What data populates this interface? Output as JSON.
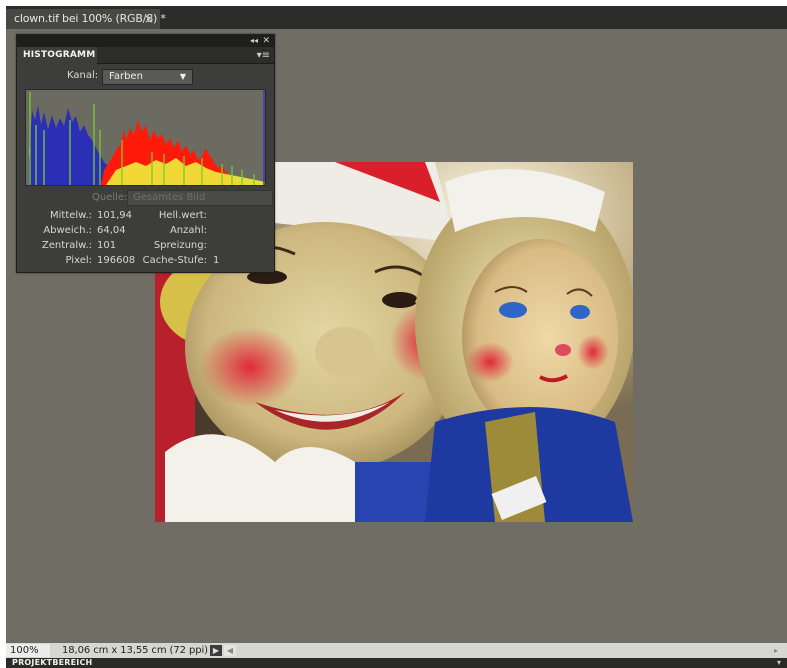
{
  "document_tab": {
    "title": "clown.tif bei 100% (RGB/8) *",
    "close_glyph": "×"
  },
  "histogram_panel": {
    "tab_label": "HISTOGRAMM",
    "collapse_icon": "double-chevron-left-icon",
    "close_icon": "close-icon",
    "menu_icon": "panel-menu-icon",
    "kanal_label": "Kanal:",
    "kanal_value": "Farben",
    "quelle_label": "Quelle:",
    "quelle_value": "Gesamtes Bild",
    "stats_left": [
      {
        "label": "Mittelw.:",
        "value": "101,94"
      },
      {
        "label": "Abweich.:",
        "value": "64,04"
      },
      {
        "label": "Zentralw.:",
        "value": "101"
      },
      {
        "label": "Pixel:",
        "value": "196608"
      }
    ],
    "stats_right": [
      {
        "label": "Hell.wert:",
        "value": ""
      },
      {
        "label": "Anzahl:",
        "value": ""
      },
      {
        "label": "Spreizung:",
        "value": ""
      },
      {
        "label": "Cache-Stufe:",
        "value": "1"
      }
    ],
    "colors": {
      "blue": "#2a2fb5",
      "red": "#ff1a0a",
      "green": "#7acb2e",
      "yellow": "#f0ee3a",
      "cyan": "#6fd0b8"
    }
  },
  "status_bar": {
    "zoom": "100%",
    "document_size": "18,06 cm x 13,55 cm (72 ppi)",
    "arrow_icon": "play-right-icon"
  },
  "project_bin": {
    "title": "PROJEKTBEREICH"
  }
}
